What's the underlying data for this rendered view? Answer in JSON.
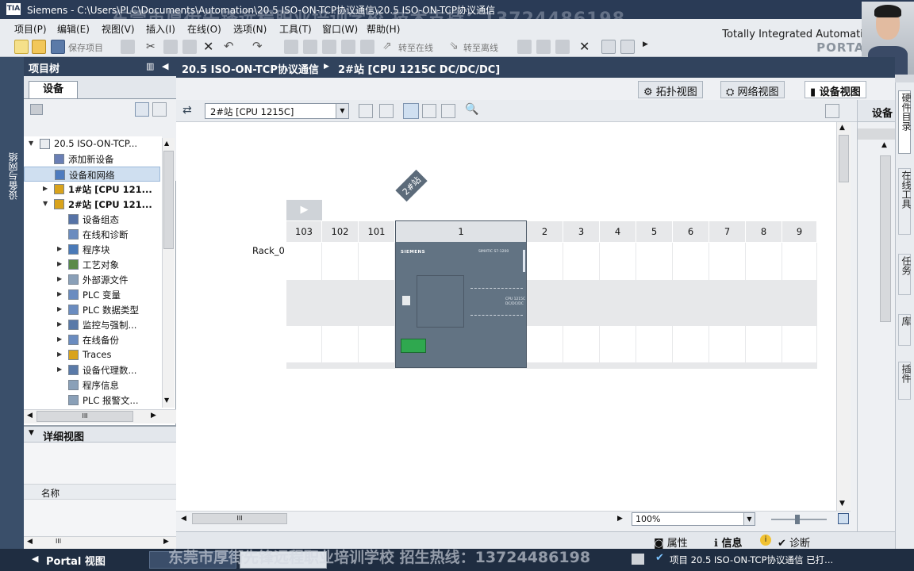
{
  "window": {
    "logo": "TIA",
    "title": "Siemens  -  C:\\Users\\PLC\\Documents\\Automation\\20.5  ISO-ON-TCP协议通信\\20.5  ISO-ON-TCP协议通信",
    "watermark_top": "东莞市厚街先锋远程职业培训学校  技术支持：13724486198",
    "brand": "Totally Integrated Automation",
    "brand2": "PORTAL"
  },
  "menu": [
    "项目(P)",
    "编辑(E)",
    "视图(V)",
    "插入(I)",
    "在线(O)",
    "选项(N)",
    "工具(T)",
    "窗口(W)",
    "帮助(H)"
  ],
  "toolbar": {
    "save_label": "保存项目",
    "go_online": "转至在线",
    "go_offline": "转至离线"
  },
  "left_vertical_tab": "设备与网络",
  "project_tree": {
    "header": "项目树",
    "devices_tab": "设备",
    "items": [
      {
        "label": "20.5  ISO-ON-TCP...",
        "level": 0,
        "expand": "▼",
        "bold": false
      },
      {
        "label": "添加新设备",
        "level": 1,
        "expand": "",
        "bold": false
      },
      {
        "label": "设备和网络",
        "level": 1,
        "expand": "",
        "bold": false
      },
      {
        "label": "1#站 [CPU 121...",
        "level": 1,
        "expand": "▶",
        "bold": true
      },
      {
        "label": "2#站 [CPU 121...",
        "level": 1,
        "expand": "▼",
        "bold": true
      },
      {
        "label": "设备组态",
        "level": 2,
        "expand": "",
        "bold": false
      },
      {
        "label": "在线和诊断",
        "level": 2,
        "expand": "",
        "bold": false
      },
      {
        "label": "程序块",
        "level": 2,
        "expand": "▶",
        "bold": false
      },
      {
        "label": "工艺对象",
        "level": 2,
        "expand": "▶",
        "bold": false
      },
      {
        "label": "外部源文件",
        "level": 2,
        "expand": "▶",
        "bold": false
      },
      {
        "label": "PLC 变量",
        "level": 2,
        "expand": "▶",
        "bold": false
      },
      {
        "label": "PLC 数据类型",
        "level": 2,
        "expand": "▶",
        "bold": false
      },
      {
        "label": "监控与强制...",
        "level": 2,
        "expand": "▶",
        "bold": false
      },
      {
        "label": "在线备份",
        "level": 2,
        "expand": "▶",
        "bold": false
      },
      {
        "label": "Traces",
        "level": 2,
        "expand": "▶",
        "bold": false
      },
      {
        "label": "设备代理数...",
        "level": 2,
        "expand": "▶",
        "bold": false
      },
      {
        "label": "程序信息",
        "level": 2,
        "expand": "",
        "bold": false
      },
      {
        "label": "PLC 报警文...",
        "level": 2,
        "expand": "",
        "bold": false
      }
    ],
    "selected_item": "设备和网络",
    "scroll_mark": "III"
  },
  "detail_view": {
    "header": "详细视图",
    "column_name": "名称",
    "scroll_mark": "III"
  },
  "main": {
    "breadcrumb_project": "20.5  ISO-ON-TCP协议通信",
    "breadcrumb_device": "2#站 [CPU 1215C DC/DC/DC]",
    "view_tabs": [
      "拓扑视图",
      "网络视图",
      "设备视图"
    ],
    "active_view": "设备视图",
    "device_selector": "2#站 [CPU 1215C]",
    "station_tag": "2#站",
    "rack_label": "Rack_0",
    "slots": [
      "103",
      "102",
      "101",
      "1",
      "2",
      "3",
      "4",
      "5",
      "6",
      "7",
      "8",
      "9"
    ],
    "cpu": {
      "brand": "SIEMENS",
      "model_line": "SIMATIC S7-1200",
      "type_line1": "CPU 1215C",
      "type_line2": "DC/DC/DC"
    },
    "zoom": "100%",
    "scroll_mark": "III"
  },
  "side_panel": {
    "label": "设备"
  },
  "right_strip": [
    "硬件目录",
    "在线工具",
    "任务",
    "库",
    "插件"
  ],
  "bottom": {
    "portal_view": "Portal 视图",
    "tabs": [
      "属性",
      "信息",
      "诊断"
    ],
    "status": "项目 20.5  ISO-ON-TCP协议通信 已打...",
    "watermark_bottom": "东莞市厚街先锋远程职业培训学校  招生热线：13724486198"
  },
  "colors": {
    "header": "#31435d",
    "cpu_body": "#627383",
    "cpu_port": "#2fa84f"
  }
}
